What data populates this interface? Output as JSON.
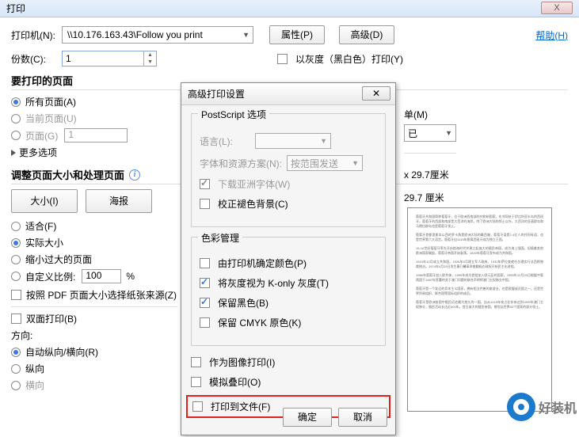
{
  "main": {
    "title": "打印",
    "close_x": "X",
    "printer_label": "打印机(N):",
    "printer_value": "\\\\10.176.163.43\\Follow you print",
    "btn_properties": "属性(P)",
    "btn_advanced": "高级(D)",
    "help_link": "帮助(H)",
    "copies_label": "份数(C):",
    "copies_value": "1",
    "grayscale_chk": "以灰度（黑白色）打印(Y)"
  },
  "pages": {
    "header": "要打印的页面",
    "all": "所有页面(A)",
    "current": "当前页面(U)",
    "range": "页面(G)",
    "range_value": "1",
    "more": "更多选项"
  },
  "scale": {
    "header": "调整页面大小和处理页面",
    "btn_size": "大小(I)",
    "btn_poster": "海报",
    "fit": "适合(F)",
    "actual": "实际大小",
    "shrink": "缩小过大的页面",
    "custom": "自定义比例:",
    "custom_value": "100",
    "pct": "%",
    "bysource": "按照 PDF 页面大小选择纸张来源(Z)",
    "duplex": "双面打印(B)",
    "orient_label": "方向:",
    "auto": "自动纵向/横向(R)",
    "portrait": "纵向",
    "landscape": "横向"
  },
  "adv": {
    "title": "高级打印设置",
    "close_x": "✕",
    "ps_legend": "PostScript 选项",
    "lang_label": "语言(L):",
    "policy_label": "字体和资源方案(N):",
    "policy_value": "按范围发送",
    "dl_asian": "下载亚洲字体(W)",
    "discol": "校正褪色背景(C)",
    "color_legend": "色彩管理",
    "col_printer": "由打印机确定颜色(P)",
    "col_kgray": "将灰度视为 K-only 灰度(T)",
    "col_black": "保留黑色(B)",
    "col_cmyk": "保留 CMYK 原色(K)",
    "as_image": "作为图像打印(I)",
    "simulate": "模拟叠印(O)",
    "to_file": "打印到文件(F)",
    "ok": "确定",
    "cancel": "取消"
  },
  "right": {
    "unit_label": "单(M)",
    "unit_value": "已",
    "size1": "x 29.7厘米",
    "size2": "29.7 厘米"
  },
  "wm": {
    "text": "好装机"
  }
}
